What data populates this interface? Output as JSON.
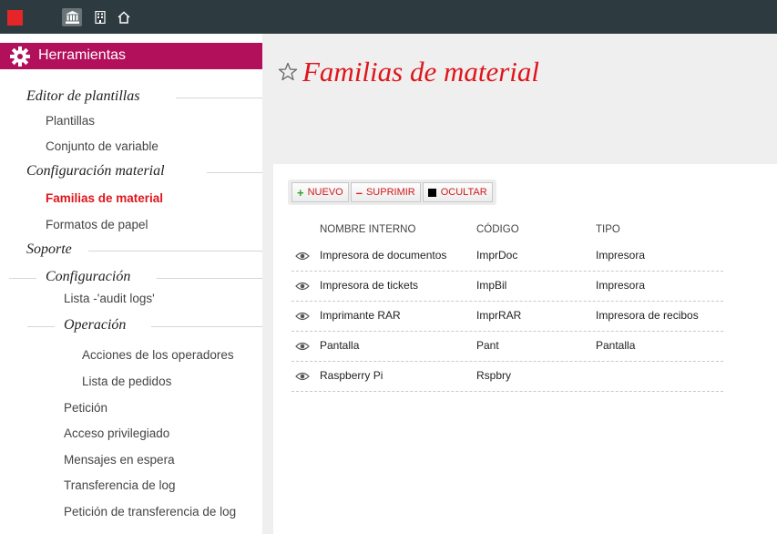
{
  "topbar": {
    "icons": [
      "bank-icon",
      "building-icon",
      "home-icon"
    ]
  },
  "sidebar": {
    "header": "Herramientas",
    "groups": {
      "editor": "Editor de plantillas",
      "config_material": "Configuración material",
      "soporte": "Soporte",
      "configuracion": "Configuración",
      "operacion": "Operación"
    },
    "items": {
      "plantillas": "Plantillas",
      "conjunto": "Conjunto de variable",
      "familias": "Familias de material",
      "formatos": "Formatos de papel",
      "audit": "Lista -'audit logs'",
      "acciones": "Acciones de los operadores",
      "pedidos": "Lista de pedidos",
      "peticion": "Petición",
      "acceso": "Acceso privilegiado",
      "mensajes": "Mensajes en espera",
      "transferencia": "Transferencia de log",
      "peticion_transferencia": "Petición de transferencia de log"
    },
    "active_item": "Familias de material"
  },
  "main": {
    "title": "Familias de material",
    "toolbar": {
      "nuevo": "NUEVO",
      "suprimir": "SUPRIMIR",
      "ocultar": "OCULTAR"
    },
    "table": {
      "headers": [
        "NOMBRE INTERNO",
        "CÓDIGO",
        "TIPO"
      ],
      "rows": [
        [
          "Impresora de documentos",
          "ImprDoc",
          "Impresora"
        ],
        [
          "Impresora de tickets",
          "ImpBil",
          "Impresora"
        ],
        [
          "Imprimante RAR",
          "ImprRAR",
          "Impresora de recibos"
        ],
        [
          "Pantalla",
          "Pant",
          "Pantalla"
        ],
        [
          "Raspberry Pi",
          "Rspbry",
          ""
        ]
      ]
    }
  },
  "colors": {
    "topbar": "#2d3a3f",
    "accent_magenta": "#b2105b",
    "accent_red": "#e0151b",
    "add_green": "#2fa12f"
  }
}
